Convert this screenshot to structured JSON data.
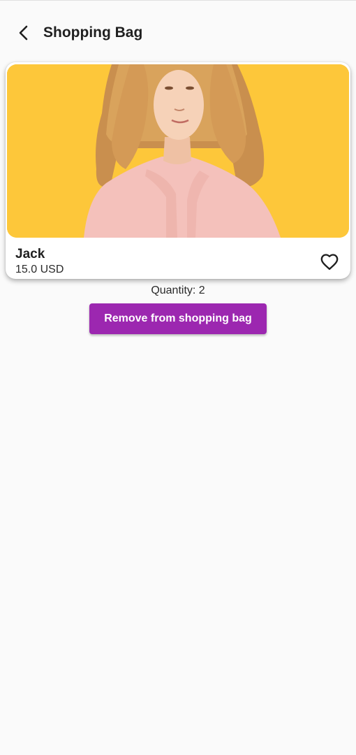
{
  "header": {
    "title": "Shopping Bag",
    "back_icon": "chevron-left-icon"
  },
  "product": {
    "name": "Jack",
    "price": "15.0 USD",
    "image_background": "#fdc73a",
    "favorite_icon": "heart-outline-icon"
  },
  "bag": {
    "quantity_text": "Quantity: 2",
    "remove_label": "Remove from shopping bag",
    "accent_color": "#9c27b0"
  }
}
